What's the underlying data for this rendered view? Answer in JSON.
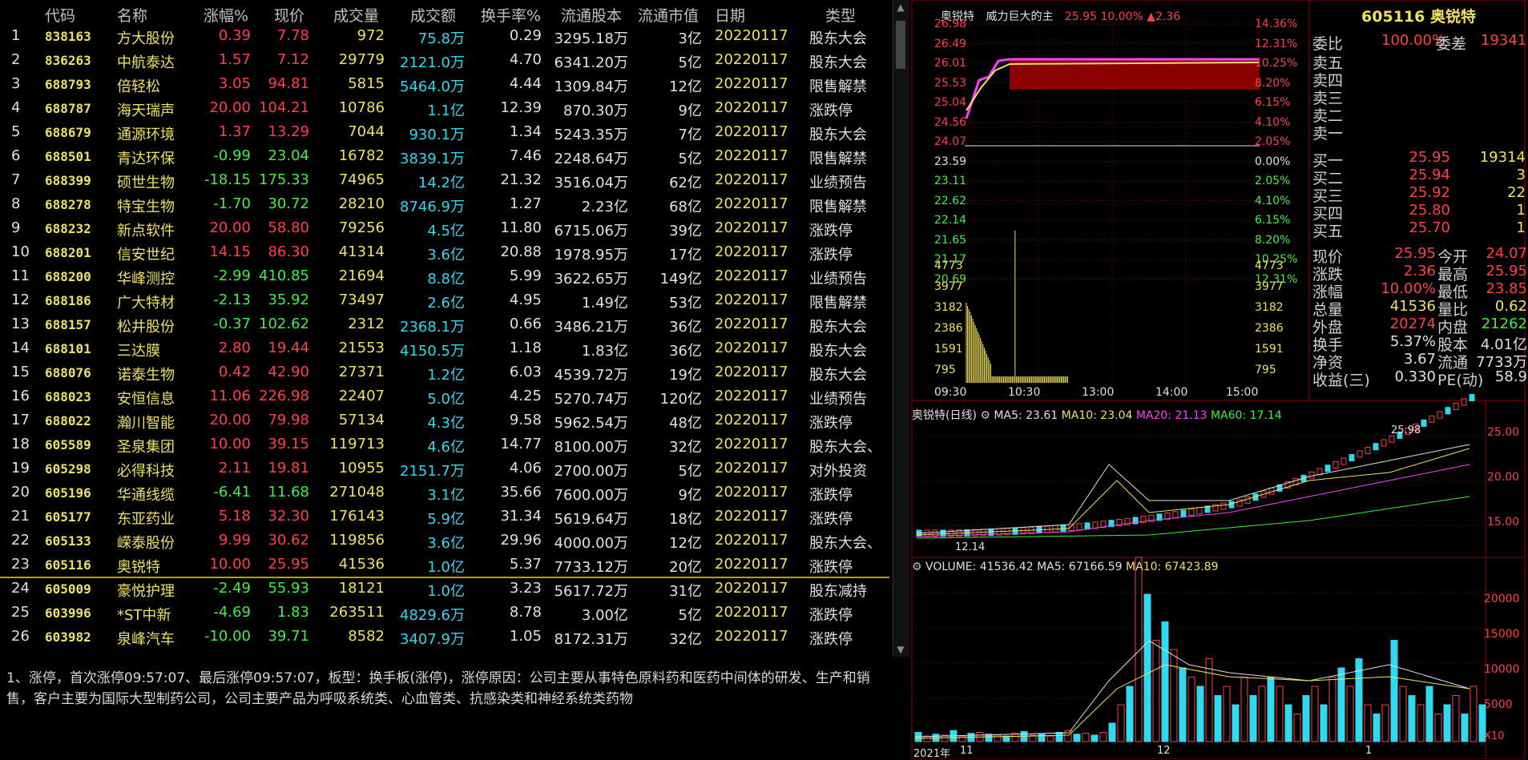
{
  "columns": [
    "代码",
    "名称",
    "涨幅%",
    "现价",
    "成交量",
    "成交额",
    "换手率%",
    "流通股本",
    "流通市值",
    "日期",
    "类型"
  ],
  "rows": [
    {
      "n": "1",
      "code": "838163",
      "name": "方大股份",
      "pct": "0.39",
      "price": "7.78",
      "vol": "972",
      "amt": "75.8万",
      "turn": "0.29",
      "cap": "3295.18万",
      "mv": "3亿",
      "date": "20220117",
      "type": "股东大会",
      "dir": "up"
    },
    {
      "n": "2",
      "code": "836263",
      "name": "中航泰达",
      "pct": "1.57",
      "price": "7.12",
      "vol": "29779",
      "amt": "2121.0万",
      "turn": "4.70",
      "cap": "6341.20万",
      "mv": "5亿",
      "date": "20220117",
      "type": "股东大会",
      "dir": "up"
    },
    {
      "n": "3",
      "code": "688793",
      "name": "倍轻松",
      "pct": "3.05",
      "price": "94.81",
      "vol": "5815",
      "amt": "5464.0万",
      "turn": "4.44",
      "cap": "1309.84万",
      "mv": "12亿",
      "date": "20220117",
      "type": "限售解禁",
      "dir": "up"
    },
    {
      "n": "4",
      "code": "688787",
      "name": "海天瑞声",
      "pct": "20.00",
      "price": "104.21",
      "vol": "10786",
      "amt": "1.1亿",
      "turn": "12.39",
      "cap": "870.30万",
      "mv": "9亿",
      "date": "20220117",
      "type": "涨跌停",
      "dir": "up"
    },
    {
      "n": "5",
      "code": "688679",
      "name": "通源环境",
      "pct": "1.37",
      "price": "13.29",
      "vol": "7044",
      "amt": "930.1万",
      "turn": "1.34",
      "cap": "5243.35万",
      "mv": "7亿",
      "date": "20220117",
      "type": "股东大会",
      "dir": "up"
    },
    {
      "n": "6",
      "code": "688501",
      "name": "青达环保",
      "pct": "-0.99",
      "price": "23.04",
      "vol": "16782",
      "amt": "3839.1万",
      "turn": "7.46",
      "cap": "2248.64万",
      "mv": "5亿",
      "date": "20220117",
      "type": "限售解禁",
      "dir": "dn"
    },
    {
      "n": "7",
      "code": "688399",
      "name": "硕世生物",
      "pct": "-18.15",
      "price": "175.33",
      "vol": "74965",
      "amt": "14.2亿",
      "turn": "21.32",
      "cap": "3516.04万",
      "mv": "62亿",
      "date": "20220117",
      "type": "业绩预告",
      "dir": "dn"
    },
    {
      "n": "8",
      "code": "688278",
      "name": "特宝生物",
      "pct": "-1.70",
      "price": "30.72",
      "vol": "28210",
      "amt": "8746.9万",
      "turn": "1.27",
      "cap": "2.23亿",
      "mv": "68亿",
      "date": "20220117",
      "type": "限售解禁",
      "dir": "dn"
    },
    {
      "n": "9",
      "code": "688232",
      "name": "新点软件",
      "pct": "20.00",
      "price": "58.80",
      "vol": "79256",
      "amt": "4.5亿",
      "turn": "11.80",
      "cap": "6715.06万",
      "mv": "39亿",
      "date": "20220117",
      "type": "涨跌停",
      "dir": "up"
    },
    {
      "n": "10",
      "code": "688201",
      "name": "信安世纪",
      "pct": "14.15",
      "price": "86.30",
      "vol": "41314",
      "amt": "3.6亿",
      "turn": "20.88",
      "cap": "1978.95万",
      "mv": "17亿",
      "date": "20220117",
      "type": "涨跌停",
      "dir": "up"
    },
    {
      "n": "11",
      "code": "688200",
      "name": "华峰测控",
      "pct": "-2.99",
      "price": "410.85",
      "vol": "21694",
      "amt": "8.8亿",
      "turn": "5.99",
      "cap": "3622.65万",
      "mv": "149亿",
      "date": "20220117",
      "type": "业绩预告",
      "dir": "dn"
    },
    {
      "n": "12",
      "code": "688186",
      "name": "广大特材",
      "pct": "-2.13",
      "price": "35.92",
      "vol": "73497",
      "amt": "2.6亿",
      "turn": "4.95",
      "cap": "1.49亿",
      "mv": "53亿",
      "date": "20220117",
      "type": "限售解禁",
      "dir": "dn"
    },
    {
      "n": "13",
      "code": "688157",
      "name": "松井股份",
      "pct": "-0.37",
      "price": "102.62",
      "vol": "2312",
      "amt": "2368.1万",
      "turn": "0.66",
      "cap": "3486.21万",
      "mv": "36亿",
      "date": "20220117",
      "type": "股东大会",
      "dir": "dn"
    },
    {
      "n": "14",
      "code": "688101",
      "name": "三达膜",
      "pct": "2.80",
      "price": "19.44",
      "vol": "21553",
      "amt": "4150.5万",
      "turn": "1.18",
      "cap": "1.83亿",
      "mv": "36亿",
      "date": "20220117",
      "type": "股东大会",
      "dir": "up"
    },
    {
      "n": "15",
      "code": "688076",
      "name": "诺泰生物",
      "pct": "0.42",
      "price": "42.90",
      "vol": "27371",
      "amt": "1.2亿",
      "turn": "6.03",
      "cap": "4539.72万",
      "mv": "19亿",
      "date": "20220117",
      "type": "股东大会",
      "dir": "up"
    },
    {
      "n": "16",
      "code": "688023",
      "name": "安恒信息",
      "pct": "11.06",
      "price": "226.98",
      "vol": "22407",
      "amt": "5.0亿",
      "turn": "4.25",
      "cap": "5270.74万",
      "mv": "120亿",
      "date": "20220117",
      "type": "业绩预告",
      "dir": "up"
    },
    {
      "n": "17",
      "code": "688022",
      "name": "瀚川智能",
      "pct": "20.00",
      "price": "79.98",
      "vol": "57134",
      "amt": "4.3亿",
      "turn": "9.58",
      "cap": "5962.54万",
      "mv": "48亿",
      "date": "20220117",
      "type": "涨跌停",
      "dir": "up"
    },
    {
      "n": "18",
      "code": "605589",
      "name": "圣泉集团",
      "pct": "10.00",
      "price": "39.15",
      "vol": "119713",
      "amt": "4.6亿",
      "turn": "14.77",
      "cap": "8100.00万",
      "mv": "32亿",
      "date": "20220117",
      "type": "股东大会、",
      "dir": "up"
    },
    {
      "n": "19",
      "code": "605298",
      "name": "必得科技",
      "pct": "2.11",
      "price": "19.81",
      "vol": "10955",
      "amt": "2151.7万",
      "turn": "4.06",
      "cap": "2700.00万",
      "mv": "5亿",
      "date": "20220117",
      "type": "对外投资",
      "dir": "up"
    },
    {
      "n": "20",
      "code": "605196",
      "name": "华通线缆",
      "pct": "-6.41",
      "price": "11.68",
      "vol": "271048",
      "amt": "3.1亿",
      "turn": "35.66",
      "cap": "7600.00万",
      "mv": "9亿",
      "date": "20220117",
      "type": "涨跌停",
      "dir": "dn"
    },
    {
      "n": "21",
      "code": "605177",
      "name": "东亚药业",
      "pct": "5.18",
      "price": "32.30",
      "vol": "176143",
      "amt": "5.9亿",
      "turn": "31.34",
      "cap": "5619.64万",
      "mv": "18亿",
      "date": "20220117",
      "type": "涨跌停",
      "dir": "up"
    },
    {
      "n": "22",
      "code": "605133",
      "name": "嵘泰股份",
      "pct": "9.99",
      "price": "30.62",
      "vol": "119856",
      "amt": "3.6亿",
      "turn": "29.96",
      "cap": "4000.00万",
      "mv": "12亿",
      "date": "20220117",
      "type": "股东大会、",
      "dir": "up"
    },
    {
      "n": "23",
      "code": "605116",
      "name": "奥锐特",
      "pct": "10.00",
      "price": "25.95",
      "vol": "41536",
      "amt": "1.0亿",
      "turn": "5.37",
      "cap": "7733.12万",
      "mv": "20亿",
      "date": "20220117",
      "type": "涨跌停",
      "dir": "up"
    },
    {
      "n": "24",
      "code": "605009",
      "name": "豪悦护理",
      "pct": "-2.49",
      "price": "55.93",
      "vol": "18121",
      "amt": "1.0亿",
      "turn": "3.23",
      "cap": "5617.72万",
      "mv": "31亿",
      "date": "20220117",
      "type": "股东减持",
      "dir": "dn"
    },
    {
      "n": "25",
      "code": "603996",
      "name": "*ST中新",
      "pct": "-4.69",
      "price": "1.83",
      "vol": "263511",
      "amt": "4829.6万",
      "turn": "8.78",
      "cap": "3.00亿",
      "mv": "5亿",
      "date": "20220117",
      "type": "涨跌停",
      "dir": "dn"
    },
    {
      "n": "26",
      "code": "603982",
      "name": "泉峰汽车",
      "pct": "-10.00",
      "price": "39.71",
      "vol": "8582",
      "amt": "3407.9万",
      "turn": "1.05",
      "cap": "8172.31万",
      "mv": "32亿",
      "date": "20220117",
      "type": "涨跌停",
      "dir": "dn"
    }
  ],
  "note": "1、涨停，首次涨停09:57:07、最后涨停09:57:07，板型：换手板(涨停)，涨停原因：公司主要从事特色原料药和医药中间体的研发、生产和销售，客户主要为国际大型制药公司，公司主要产品为呼吸系统类、心血管类、抗感染类和神经系统类药物",
  "intraday": {
    "name": "奥锐特",
    "desc": "威力巨大的主",
    "price": "25.95",
    "pct": "10.00%",
    "chg": "▲2.36",
    "price_ticks": [
      "26.98",
      "26.49",
      "26.01",
      "25.53",
      "25.04",
      "24.56",
      "24.07",
      "23.59",
      "23.11",
      "22.62",
      "22.14",
      "21.65",
      "21.17",
      "20.69"
    ],
    "pct_ticks": [
      "14.36%",
      "12.31%",
      "10.25%",
      "8.20%",
      "6.15%",
      "4.10%",
      "2.05%",
      "0.00%",
      "2.05%",
      "4.10%",
      "6.15%",
      "8.20%",
      "10.25%",
      "12.31%"
    ],
    "vol_ticks": [
      "4773",
      "3977",
      "3182",
      "2386",
      "1591",
      "795"
    ],
    "time_ticks": [
      "09:30",
      "10:30",
      "13:00",
      "14:00",
      "15:00"
    ]
  },
  "quote": {
    "title": "605116 奥锐特",
    "weibi_label": "委比",
    "weibi": "100.00%",
    "weicha_label": "委差",
    "weicha": "19341",
    "sell": [
      {
        "l": "卖五",
        "p": "",
        "v": ""
      },
      {
        "l": "卖四",
        "p": "",
        "v": ""
      },
      {
        "l": "卖三",
        "p": "",
        "v": ""
      },
      {
        "l": "卖二",
        "p": "",
        "v": ""
      },
      {
        "l": "卖一",
        "p": "",
        "v": ""
      }
    ],
    "buy": [
      {
        "l": "买一",
        "p": "25.95",
        "v": "19314"
      },
      {
        "l": "买二",
        "p": "25.94",
        "v": "3"
      },
      {
        "l": "买三",
        "p": "25.92",
        "v": "22"
      },
      {
        "l": "买四",
        "p": "25.80",
        "v": "1"
      },
      {
        "l": "买五",
        "p": "25.70",
        "v": "1"
      }
    ],
    "stats": [
      {
        "l1": "现价",
        "v1": "25.95",
        "c1": "ud",
        "l2": "今开",
        "v2": "24.07",
        "c2": "ud"
      },
      {
        "l1": "涨跌",
        "v1": "2.36",
        "c1": "ud",
        "l2": "最高",
        "v2": "25.95",
        "c2": "ud"
      },
      {
        "l1": "涨幅",
        "v1": "10.00%",
        "c1": "ud",
        "l2": "最低",
        "v2": "23.85",
        "c2": "ud"
      },
      {
        "l1": "总量",
        "v1": "41536",
        "c1": "yel",
        "l2": "量比",
        "v2": "0.62",
        "c2": "yel"
      },
      {
        "l1": "外盘",
        "v1": "20274",
        "c1": "ud",
        "l2": "内盘",
        "v2": "21262",
        "c2": "dn"
      },
      {
        "l1": "换手",
        "v1": "5.37%",
        "c1": "wht",
        "l2": "股本",
        "v2": "4.01亿",
        "c2": "wht"
      },
      {
        "l1": "净资",
        "v1": "3.67",
        "c1": "wht",
        "l2": "流通",
        "v2": "7733万",
        "c2": "wht"
      },
      {
        "l1": "收益(三)",
        "v1": "0.330",
        "c1": "wht",
        "l2": "PE(动)",
        "v2": "58.9",
        "c2": "wht"
      }
    ]
  },
  "daily": {
    "title": "奥锐特(日线)",
    "ma5": "MA5: 23.61",
    "ma10": "MA10: 23.04",
    "ma20": "MA20: 21.13",
    "ma60": "MA60: 17.14",
    "high_label": "25.98",
    "low_label": "12.14",
    "price_ticks": [
      "25.00",
      "20.00",
      "15.00"
    ]
  },
  "volume": {
    "title": "VOLUME: 41536.42",
    "ma5": "MA5: 67166.59",
    "ma10": "MA10: 67423.89",
    "ticks": [
      "20000",
      "15000",
      "10000",
      "5000"
    ],
    "unit": "X10",
    "date_ticks": [
      "2021年",
      "11",
      "12",
      "1"
    ]
  },
  "colors": {
    "up": "#ff4040",
    "down": "#3cf03c",
    "yellow": "#f0e060",
    "cyan": "#30d8f0",
    "grid": "#8b0000"
  }
}
